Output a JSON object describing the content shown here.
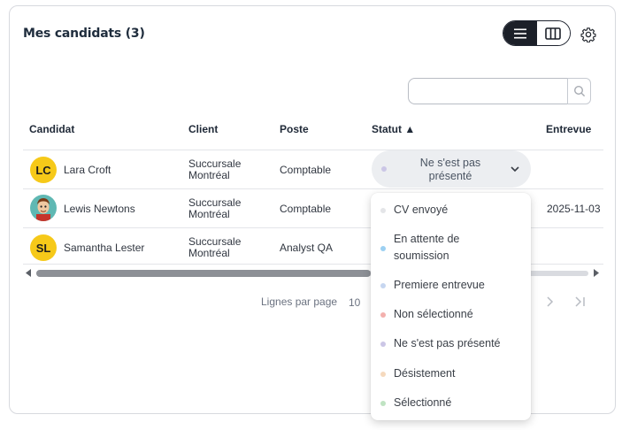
{
  "header": {
    "title": "Mes candidats (3)",
    "view_toggle": [
      "list-view",
      "column-view"
    ],
    "settings_icon": "gear-icon"
  },
  "search": {
    "value": "",
    "placeholder": "",
    "button_icon": "search-icon"
  },
  "table": {
    "columns": [
      "Candidat",
      "Client",
      "Poste",
      "Statut ▲",
      "Entrevue"
    ],
    "rows": [
      {
        "initials": "LC",
        "avatar_color": "#f6c919",
        "name": "Lara Croft",
        "client_line1": "Succursale",
        "client_line2": "Montréal",
        "poste": "Comptable",
        "statut": "Ne s'est pas présenté",
        "entrevue": ""
      },
      {
        "initials": "",
        "avatar": "photo",
        "name": "Lewis Newtons",
        "client_line1": "Succursale",
        "client_line2": "Montréal",
        "poste": "Comptable",
        "statut": "",
        "entrevue": "2025-11-03"
      },
      {
        "initials": "SL",
        "avatar_color": "#f6c919",
        "name": "Samantha Lester",
        "client_line1": "Succursale",
        "client_line2": "Montréal",
        "poste": "Analyst QA",
        "statut": "",
        "entrevue": ""
      }
    ]
  },
  "pagination": {
    "rows_per_page_label": "Lignes par page",
    "rows_per_page": "10"
  },
  "status_dropdown": {
    "options": [
      {
        "label": "CV envoyé",
        "color": "#e4e5e8"
      },
      {
        "label": "En attente de soumission",
        "color": "#9cd0f2"
      },
      {
        "label": "Premiere entrevue",
        "color": "#c6d6f0"
      },
      {
        "label": "Non sélectionné",
        "color": "#f3b0ad"
      },
      {
        "label": "Ne s'est pas présenté",
        "color": "#cbc6e6"
      },
      {
        "label": "Désistement",
        "color": "#f5d9bd"
      },
      {
        "label": "Sélectionné",
        "color": "#bfe3c2"
      }
    ]
  }
}
